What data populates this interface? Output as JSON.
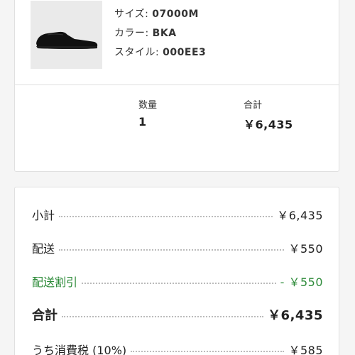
{
  "product": {
    "size_label": "サイズ: ",
    "size_value": "07000M",
    "color_label": "カラー: ",
    "color_value": "BKA",
    "style_label": "スタイル: ",
    "style_value": "000EE3",
    "quantity_label": "数量",
    "quantity_value": "1",
    "total_label": "合計",
    "total_value": "￥6,435"
  },
  "summary": {
    "subtotal_label": "小計",
    "subtotal_value": "￥6,435",
    "shipping_label": "配送",
    "shipping_value": "￥550",
    "discount_label": "配送割引",
    "discount_value": "- ￥550",
    "total_label": "合計",
    "total_value": "￥6,435",
    "tax_label": "うち消費税 (10%)",
    "tax_value": "￥585"
  },
  "colors": {
    "discount": "#2e8b3a",
    "card_border": "#e0e0e0",
    "background": "#f5f5f5"
  },
  "icons": {
    "product_image": "black-sneaker-image"
  }
}
